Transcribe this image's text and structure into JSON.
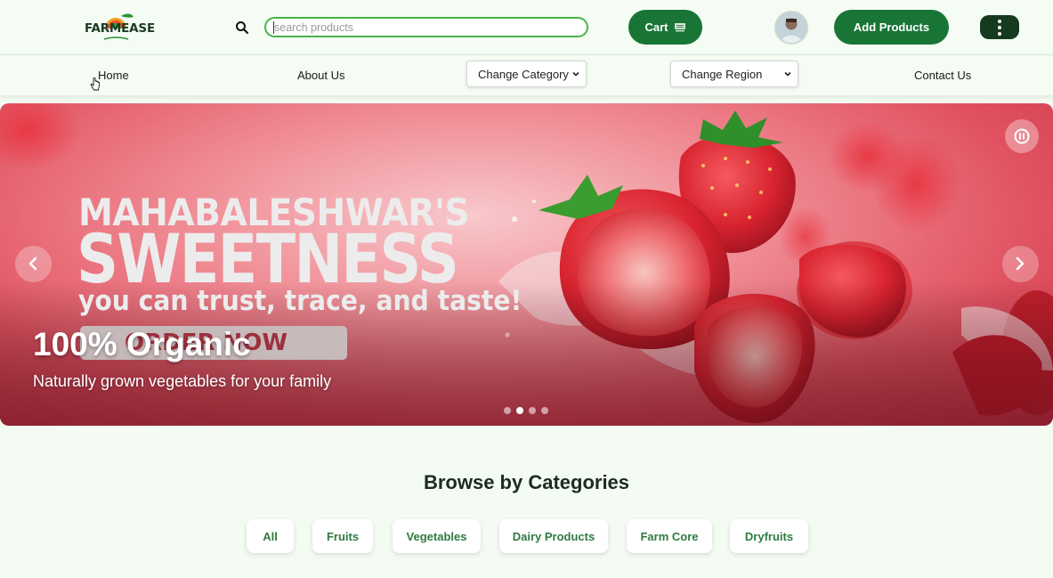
{
  "header": {
    "logo_text": "FARMEASE",
    "search_placeholder": "search products",
    "cart_label": "Cart",
    "add_products_label": "Add Products"
  },
  "nav": {
    "home": "Home",
    "about": "About Us",
    "category_select": "Change Category",
    "region_select": "Change Region",
    "contact": "Contact Us"
  },
  "hero": {
    "headline_line1": "MAHABALESHWAR'S",
    "headline_line2": "SWEETNESS",
    "headline_line3": "you can trust, trace, and taste!",
    "order_button_text": "ORDER NOW",
    "caption_title": "100% Organic",
    "caption_subtitle": "Naturally grown vegetables for your family",
    "slide_count": 4,
    "active_slide": 2
  },
  "categories": {
    "title": "Browse by Categories",
    "items": [
      "All",
      "Fruits",
      "Vegetables",
      "Dairy Products",
      "Farm Core",
      "Dryfruits"
    ]
  },
  "colors": {
    "primary_green": "#187536",
    "dark_green": "#153a20",
    "accent_green": "#49b349",
    "page_bg": "#f3fbf3"
  },
  "icons": [
    "search-icon",
    "cart-icon",
    "kebab-menu-icon",
    "chevron-down-icon",
    "chevron-left-icon",
    "chevron-right-icon",
    "pause-icon"
  ]
}
